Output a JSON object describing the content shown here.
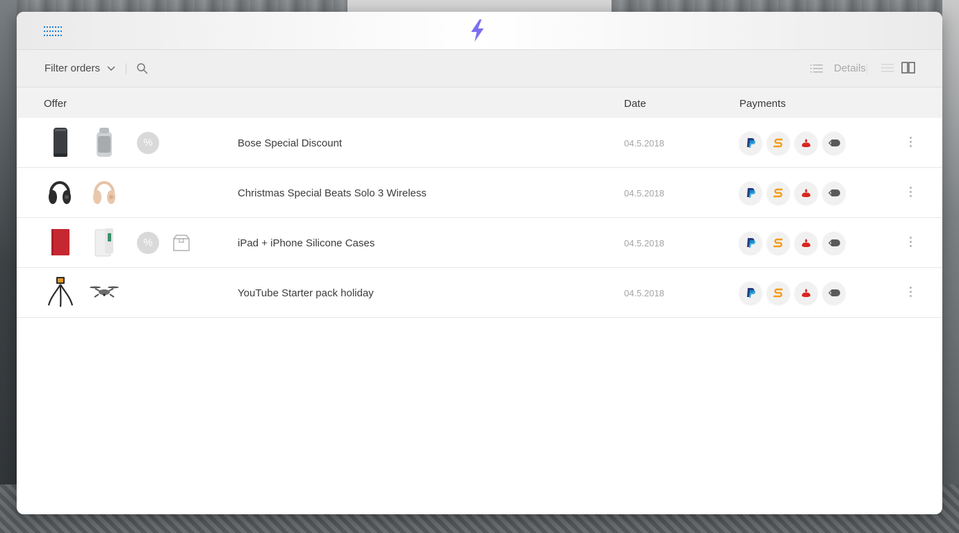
{
  "toolbar": {
    "filter_label": "Filter orders",
    "details_label": "Details"
  },
  "columns": {
    "offer": "Offer",
    "date": "Date",
    "payments": "Payments"
  },
  "colors": {
    "accent": "#1b7fd6",
    "logo": "#7b6ff0",
    "paypal_dark": "#253b80",
    "paypal_light": "#179bd7",
    "sofort": "#f49b16",
    "santander": "#d8261f",
    "arrow_pay": "#5a5a5a"
  },
  "orders": [
    {
      "title": "Bose Special Discount",
      "date": "04.5.2018",
      "items": [
        "speaker-dark",
        "speaker-silver",
        "discount-badge"
      ],
      "payments": [
        "paypal-icon",
        "sofort-icon",
        "santander-icon",
        "arrow-pay-icon"
      ]
    },
    {
      "title": "Christmas Special Beats Solo 3 Wireless",
      "date": "04.5.2018",
      "items": [
        "headphones-black",
        "headphones-gold"
      ],
      "payments": [
        "paypal-icon",
        "sofort-icon",
        "santander-icon",
        "arrow-pay-icon"
      ]
    },
    {
      "title": "iPad + iPhone Silicone Cases",
      "date": "04.5.2018",
      "items": [
        "ipad-case-red",
        "iphone-case-white",
        "discount-badge",
        "package-icon"
      ],
      "payments": [
        "paypal-icon",
        "sofort-icon",
        "santander-icon",
        "arrow-pay-icon"
      ]
    },
    {
      "title": "YouTube Starter pack holiday",
      "date": "04.5.2018",
      "items": [
        "tripod",
        "drone"
      ],
      "payments": [
        "paypal-icon",
        "sofort-icon",
        "santander-icon",
        "arrow-pay-icon"
      ]
    }
  ],
  "discount_symbol": "%"
}
